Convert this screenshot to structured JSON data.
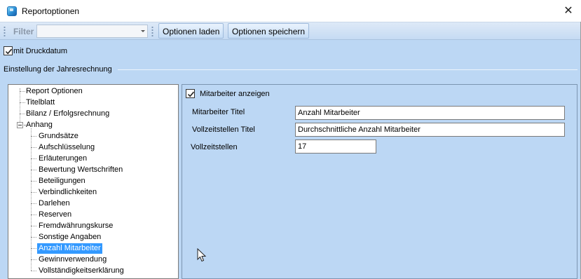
{
  "window": {
    "title": "Reportoptionen",
    "close_glyph": "✕"
  },
  "toolbar": {
    "filter_label": "Filter",
    "filter_value": "",
    "load_label": "Optionen laden",
    "save_label": "Optionen speichern"
  },
  "print_date": {
    "label": "mit Druckdatum",
    "checked": true
  },
  "group": {
    "title": "Einstellung der Jahresrechnung"
  },
  "tree": {
    "items": [
      {
        "label": "Report Optionen",
        "level": 0
      },
      {
        "label": "Titelblatt",
        "level": 0
      },
      {
        "label": "Bilanz / Erfolgsrechnung",
        "level": 0
      },
      {
        "label": "Anhang",
        "level": 0,
        "expanded": true
      },
      {
        "label": "Grundsätze",
        "level": 1
      },
      {
        "label": "Aufschlüsselung",
        "level": 1
      },
      {
        "label": "Erläuterungen",
        "level": 1
      },
      {
        "label": "Bewertung Wertschriften",
        "level": 1
      },
      {
        "label": "Beteiligungen",
        "level": 1
      },
      {
        "label": "Verbindlichkeiten",
        "level": 1
      },
      {
        "label": "Darlehen",
        "level": 1
      },
      {
        "label": "Reserven",
        "level": 1
      },
      {
        "label": "Fremdwährungskurse",
        "level": 1
      },
      {
        "label": "Sonstige Angaben",
        "level": 1
      },
      {
        "label": "Anzahl Mitarbeiter",
        "level": 1,
        "selected": true
      },
      {
        "label": "Gewinnverwendung",
        "level": 1
      },
      {
        "label": "Vollständigkeitserklärung",
        "level": 1
      }
    ]
  },
  "detail": {
    "show_employees": {
      "label": "Mitarbeiter anzeigen",
      "checked": true
    },
    "employee_title": {
      "label": "Mitarbeiter Titel",
      "value": "Anzahl Mitarbeiter"
    },
    "fte_title": {
      "label": "Vollzeitstellen Titel",
      "value": "Durchschnittliche Anzahl Mitarbeiter"
    },
    "fte": {
      "label": "Vollzeitstellen",
      "value": "17"
    }
  },
  "colors": {
    "window_bg": "#bcd7f4",
    "selection": "#3399ff",
    "toolbar_bg": "#c6dbf3"
  }
}
